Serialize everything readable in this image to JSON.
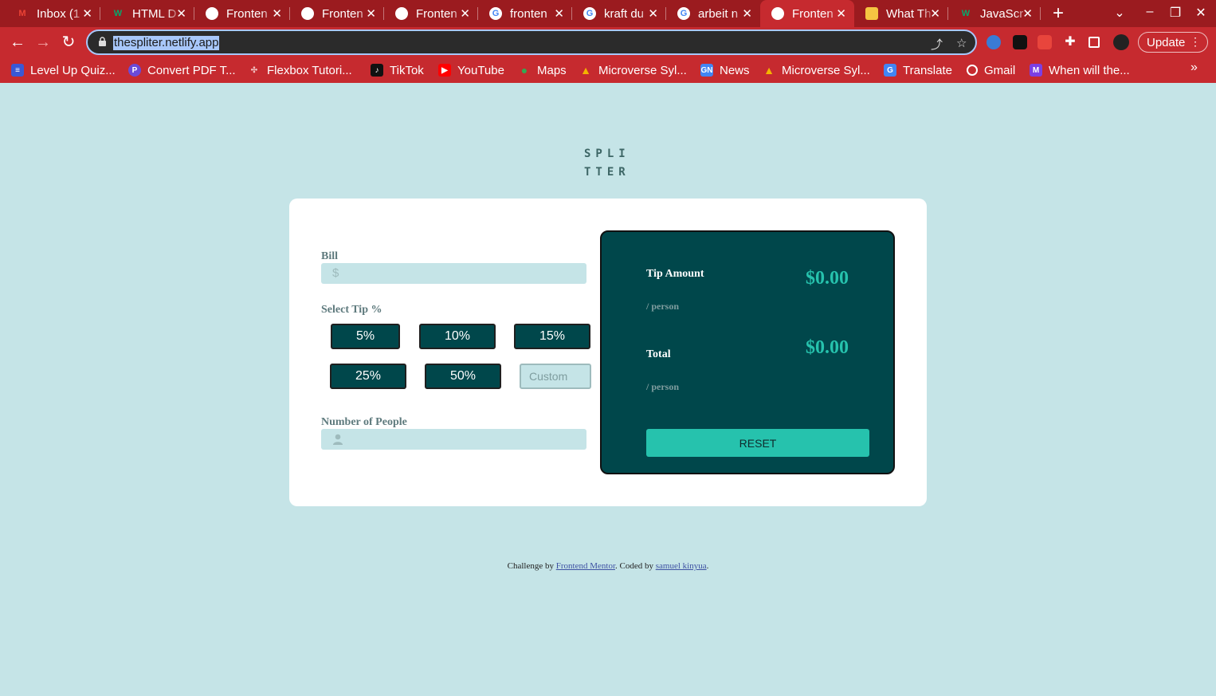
{
  "browser": {
    "tabs": [
      {
        "title": "Inbox (1",
        "favicon": "gmail-icon",
        "color": "#ea4335"
      },
      {
        "title": "HTML D",
        "favicon": "w3schools-icon",
        "color": "#04aa6d"
      },
      {
        "title": "Fronten",
        "favicon": "frontend-mentor-icon",
        "color": "#ffffff"
      },
      {
        "title": "Fronten",
        "favicon": "frontend-mentor-icon",
        "color": "#ffffff"
      },
      {
        "title": "Fronten",
        "favicon": "frontend-mentor-icon",
        "color": "#ffffff"
      },
      {
        "title": "fronten",
        "favicon": "google-icon",
        "color": "#ffffff"
      },
      {
        "title": "kraft du",
        "favicon": "google-icon",
        "color": "#ffffff"
      },
      {
        "title": "arbeit n",
        "favicon": "google-icon",
        "color": "#ffffff"
      },
      {
        "title": "Fronten",
        "favicon": "frontend-mentor-icon",
        "color": "#ffffff",
        "active": true
      },
      {
        "title": "What Th",
        "favicon": "article-icon",
        "color": "#f5c542"
      },
      {
        "title": "JavaScr",
        "favicon": "w3schools-icon",
        "color": "#04aa6d"
      }
    ],
    "url": "thespliter.netlify.app",
    "update_label": "Update",
    "bookmarks": [
      {
        "label": "Level Up Quiz...",
        "icon": "list-icon",
        "color": "#3a58d6"
      },
      {
        "label": "Convert PDF T...",
        "icon": "pdf-icon",
        "color": "#6a4ad8"
      },
      {
        "label": "Flexbox Tutori...",
        "icon": "flexbox-icon",
        "color": "#c62a2f"
      },
      {
        "label": "TikTok",
        "icon": "tiktok-icon",
        "color": "#111111"
      },
      {
        "label": "YouTube",
        "icon": "youtube-icon",
        "color": "#ff0000"
      },
      {
        "label": "Maps",
        "icon": "maps-icon",
        "color": "#34a853"
      },
      {
        "label": "Microverse Syl...",
        "icon": "drive-icon",
        "color": "#f4b400"
      },
      {
        "label": "News",
        "icon": "news-icon",
        "color": "#4285f4"
      },
      {
        "label": "Microverse Syl...",
        "icon": "drive-icon",
        "color": "#f4b400"
      },
      {
        "label": "Translate",
        "icon": "translate-icon",
        "color": "#4285f4"
      },
      {
        "label": "Gmail",
        "icon": "globe-icon",
        "color": "#444444"
      },
      {
        "label": "When will the...",
        "icon": "bookmark-icon",
        "color": "#7b3fe4"
      }
    ]
  },
  "app": {
    "logo_line1": "SPLI",
    "logo_line2": "TTER",
    "bill_label": "Bill",
    "bill_icon": "$",
    "tip_label": "Select Tip %",
    "tips": [
      "5%",
      "10%",
      "15%",
      "25%",
      "50%"
    ],
    "custom_placeholder": "Custom",
    "people_label": "Number of People",
    "tip_amount_label": "Tip Amount",
    "tip_amount_sub": "/ person",
    "tip_amount_value": "$0.00",
    "total_label": "Total",
    "total_sub": "/ person",
    "total_value": "$0.00",
    "reset_label": "RESET"
  },
  "footer": {
    "prefix": "Challenge by ",
    "link1": "Frontend Mentor",
    "middle": ". Coded by ",
    "link2": "samuel kinyua",
    "suffix": "."
  }
}
